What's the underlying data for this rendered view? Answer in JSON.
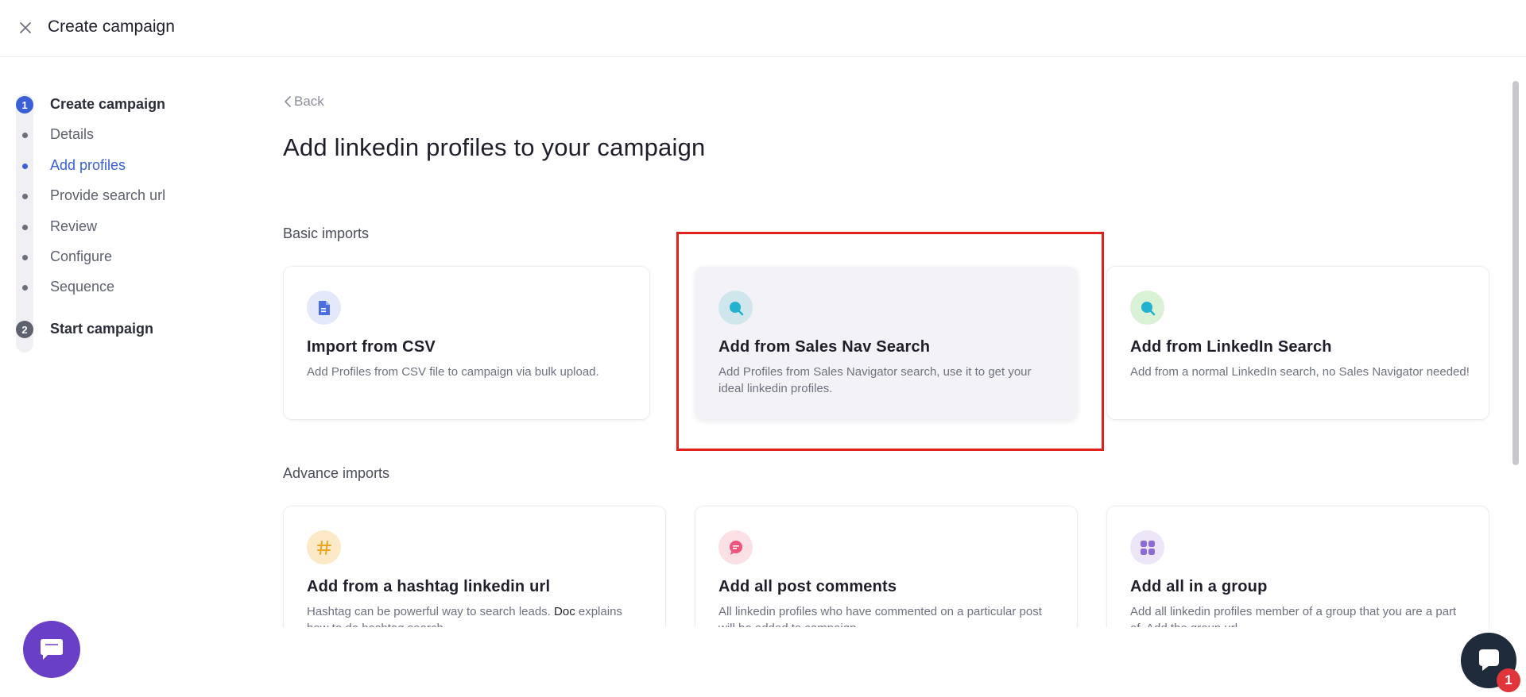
{
  "header": {
    "title": "Create campaign",
    "close_icon": "close-icon"
  },
  "stepper": {
    "steps": [
      {
        "number": "1",
        "label": "Create campaign",
        "state": "active",
        "substeps": [
          {
            "label": "Details",
            "state": "done"
          },
          {
            "label": "Add profiles",
            "state": "active"
          },
          {
            "label": "Provide search url",
            "state": "pending"
          },
          {
            "label": "Review",
            "state": "pending"
          },
          {
            "label": "Configure",
            "state": "pending"
          },
          {
            "label": "Sequence",
            "state": "pending"
          }
        ]
      },
      {
        "number": "2",
        "label": "Start campaign",
        "state": "inactive"
      }
    ]
  },
  "main": {
    "back_label": "Back",
    "title": "Add linkedin profiles to your campaign",
    "basic_section": "Basic imports",
    "advance_section": "Advance imports",
    "basic_cards": [
      {
        "title": "Import from CSV",
        "desc": "Add Profiles from CSV file to campaign via bulk upload.",
        "icon": "document-icon"
      },
      {
        "title": "Add from Sales Nav Search",
        "desc": "Add Profiles from Sales Navigator search, use it to get your ideal linkedin profiles.",
        "icon": "search-icon"
      },
      {
        "title": "Add from LinkedIn Search",
        "desc": "Add from a normal LinkedIn search, no Sales Navigator needed!",
        "icon": "search-icon"
      }
    ],
    "advance_cards": [
      {
        "title": "Add from a hashtag linkedin url",
        "desc_plain": "Hashtag can be powerful way to search leads. ",
        "desc_link": "Doc",
        "desc_rest": " explains how to do hashtag search.",
        "icon": "hashtag-icon"
      },
      {
        "title": "Add all post comments",
        "desc": "All linkedin profiles who have commented on a particular post will be added to campaign.",
        "icon": "comment-icon"
      },
      {
        "title": "Add all in a group",
        "desc": "Add all linkedin profiles member of a group that you are a part of. Add the group url.",
        "icon": "group-icon"
      }
    ]
  },
  "chat": {
    "badge_count": "1"
  },
  "colors": {
    "accent": "#3a5fd6",
    "highlight": "#e0201a",
    "chat_purple": "#6a3fc7"
  }
}
